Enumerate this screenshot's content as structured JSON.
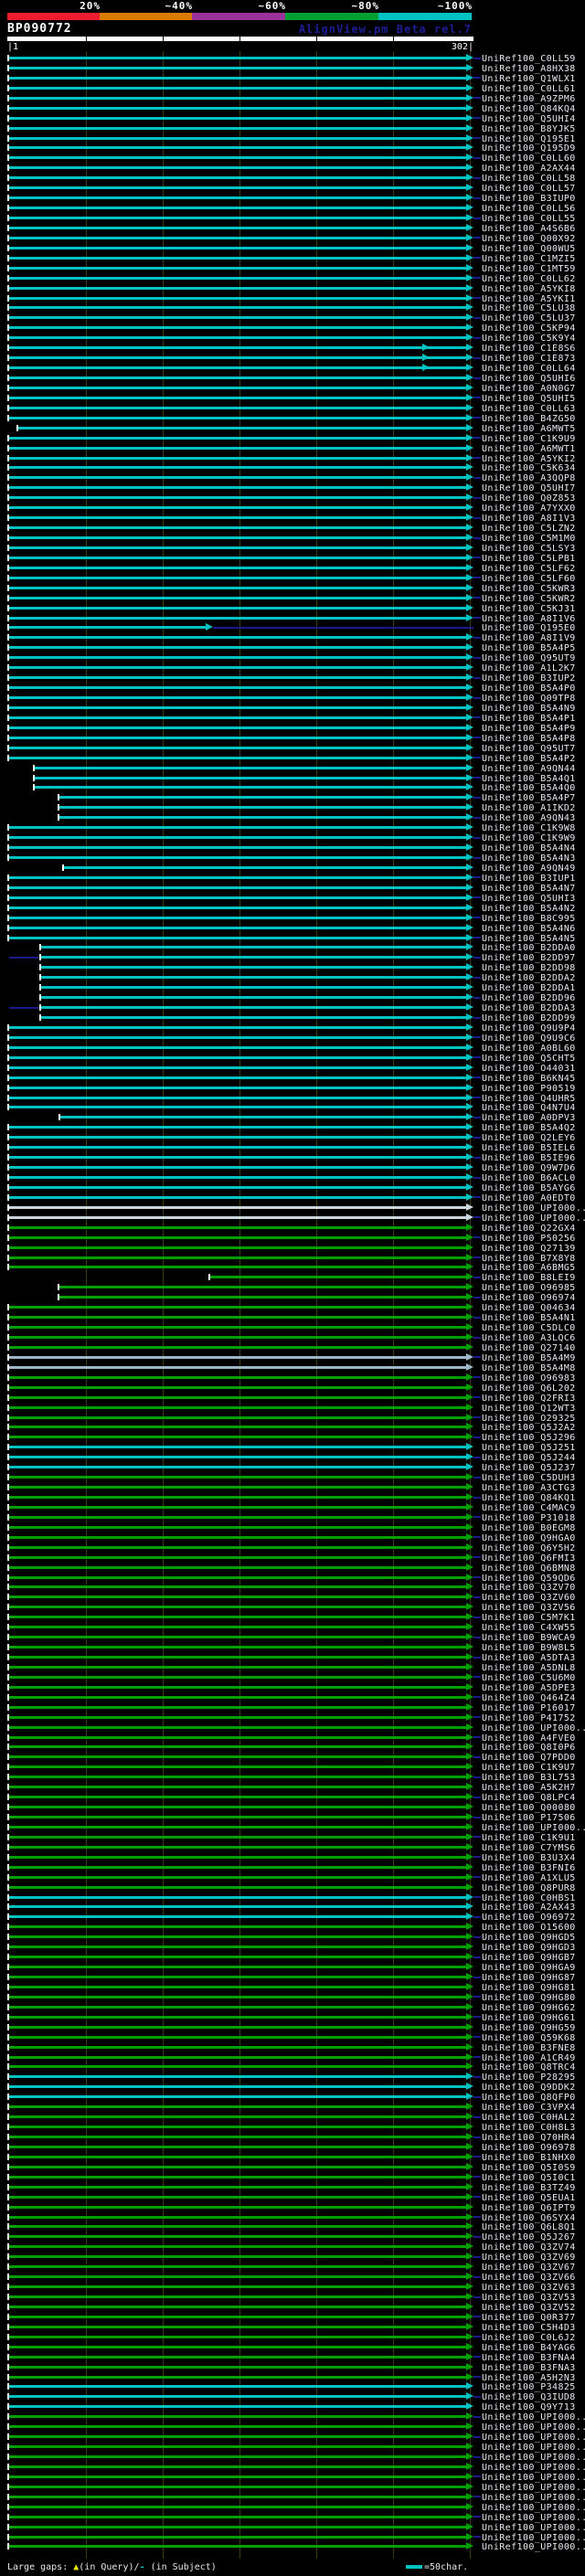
{
  "header": {
    "scale_labels": [
      "20%",
      "~40%",
      "~60%",
      "~80%",
      "~100%"
    ],
    "scale_colors": [
      "#ed1c2e",
      "#d97b00",
      "#993399",
      "#00a033",
      "#00c2c2"
    ],
    "query_id": "BP090772",
    "app_title": "AlignView.pm Beta rel.7",
    "ruler": {
      "start_label": "1",
      "end_label": "302|"
    }
  },
  "footer": {
    "large_gaps_prefix": "Large gaps: ",
    "query_gap_symbol": "▲",
    "query_gap_text": "(in Query)/",
    "subject_gap_symbol": "-",
    "subject_gap_text": " (in Subject)",
    "scale_bar_note": "=50char."
  },
  "colors": {
    "cyan": "#00c2c2",
    "green": "#00a000",
    "pale": "#c9d6dc",
    "steel": "#9db7c9",
    "navy": "#1a1a8c"
  },
  "alignment": {
    "rows": [
      {
        "label": "UniRef100_C0LL59"
      },
      {
        "label": "UniRef100_A8HX38"
      },
      {
        "label": "UniRef100_Q1WLX1"
      },
      {
        "label": "UniRef100_C0LL61"
      },
      {
        "label": "UniRef100_A9ZPM6"
      },
      {
        "label": "UniRef100_Q84KQ4"
      },
      {
        "label": "UniRef100_Q5UHI4"
      },
      {
        "label": "UniRef100_B8YJK5"
      },
      {
        "label": "UniRef100_Q195E1"
      },
      {
        "label": "UniRef100_Q195D9"
      },
      {
        "label": "UniRef100_C0LL60"
      },
      {
        "label": "UniRef100_A2AX44"
      },
      {
        "label": "UniRef100_C0LL58"
      },
      {
        "label": "UniRef100_C0LL57"
      },
      {
        "label": "UniRef100_B3IUP0"
      },
      {
        "label": "UniRef100_C0LL56"
      },
      {
        "label": "UniRef100_C0LL55"
      },
      {
        "label": "UniRef100_A4S6B6"
      },
      {
        "label": "UniRef100_Q00X92"
      },
      {
        "label": "UniRef100_Q00WU5"
      },
      {
        "label": "UniRef100_C1MZI5"
      },
      {
        "label": "UniRef100_C1MT59"
      },
      {
        "label": "UniRef100_C0LL62"
      },
      {
        "label": "UniRef100_A5YKI8"
      },
      {
        "label": "UniRef100_A5YKI1"
      },
      {
        "label": "UniRef100_C5LU38"
      },
      {
        "label": "UniRef100_C5LU37"
      },
      {
        "label": "UniRef100_C5KP94"
      },
      {
        "label": "UniRef100_C5K9Y4"
      },
      {
        "label": "UniRef100_C1E8S6",
        "m": 470
      },
      {
        "label": "UniRef100_C1E873",
        "m": 470
      },
      {
        "label": "UniRef100_C0LL64",
        "m": 470
      },
      {
        "label": "UniRef100_Q5UHI6"
      },
      {
        "label": "UniRef100_A0N0G7"
      },
      {
        "label": "UniRef100_Q5UHI5"
      },
      {
        "label": "UniRef100_C0LL63"
      },
      {
        "label": "UniRef100_B4ZG50"
      },
      {
        "label": "UniRef100_A6MWT5",
        "s": 20
      },
      {
        "label": "UniRef100_C1K9U9"
      },
      {
        "label": "UniRef100_A6MWT1"
      },
      {
        "label": "UniRef100_A5YKI2"
      },
      {
        "label": "UniRef100_C5K634"
      },
      {
        "label": "UniRef100_A3QQP8"
      },
      {
        "label": "UniRef100_Q5UHI7"
      },
      {
        "label": "UniRef100_Q0Z853"
      },
      {
        "label": "UniRef100_A7YXX0"
      },
      {
        "label": "UniRef100_A8I1V3"
      },
      {
        "label": "UniRef100_C5LZN2"
      },
      {
        "label": "UniRef100_C5M1M0"
      },
      {
        "label": "UniRef100_C5LSY3"
      },
      {
        "label": "UniRef100_C5LPB1"
      },
      {
        "label": "UniRef100_C5LF62"
      },
      {
        "label": "UniRef100_C5LF60"
      },
      {
        "label": "UniRef100_C5KWR3"
      },
      {
        "label": "UniRef100_C5KWR2"
      },
      {
        "label": "UniRef100_C5KJ31"
      },
      {
        "label": "UniRef100_A8I1V6"
      },
      {
        "label": "UniRef100_Q195E0",
        "e": 225,
        "tl": 1
      },
      {
        "label": "UniRef100_A8I1V9"
      },
      {
        "label": "UniRef100_B5A4P5"
      },
      {
        "label": "UniRef100_Q95UT9"
      },
      {
        "label": "UniRef100_A1L2K7"
      },
      {
        "label": "UniRef100_B3IUP2"
      },
      {
        "label": "UniRef100_B5A4P0"
      },
      {
        "label": "UniRef100_Q09TP8"
      },
      {
        "label": "UniRef100_B5A4N9"
      },
      {
        "label": "UniRef100_B5A4P1"
      },
      {
        "label": "UniRef100_B5A4P9"
      },
      {
        "label": "UniRef100_B5A4P8"
      },
      {
        "label": "UniRef100_Q95UT7"
      },
      {
        "label": "UniRef100_B5A4P2"
      },
      {
        "label": "UniRef100_A9QN44",
        "s": 38
      },
      {
        "label": "UniRef100_B5A4Q1",
        "s": 38
      },
      {
        "label": "UniRef100_B5A4Q0",
        "s": 38
      },
      {
        "label": "UniRef100_B5A4P7",
        "s": 65
      },
      {
        "label": "UniRef100_A1IKD2",
        "s": 65
      },
      {
        "label": "UniRef100_A9QN43",
        "s": 65
      },
      {
        "label": "UniRef100_C1K9W8"
      },
      {
        "label": "UniRef100_C1K9W9"
      },
      {
        "label": "UniRef100_B5A4N4"
      },
      {
        "label": "UniRef100_B5A4N3"
      },
      {
        "label": "UniRef100_A9QN49",
        "s": 70
      },
      {
        "label": "UniRef100_B3IUP1"
      },
      {
        "label": "UniRef100_B5A4N7"
      },
      {
        "label": "UniRef100_Q5UHI3"
      },
      {
        "label": "UniRef100_B5A4N2"
      },
      {
        "label": "UniRef100_B8C995"
      },
      {
        "label": "UniRef100_B5A4N6"
      },
      {
        "label": "UniRef100_B5A4N5"
      },
      {
        "label": "UniRef100_B2DDA0",
        "s": 45
      },
      {
        "label": "UniRef100_B2DD97",
        "s": 45,
        "ld": 1
      },
      {
        "label": "UniRef100_B2DD98",
        "s": 45
      },
      {
        "label": "UniRef100_B2DDA2",
        "s": 45
      },
      {
        "label": "UniRef100_B2DDA1",
        "s": 45
      },
      {
        "label": "UniRef100_B2DD96",
        "s": 45
      },
      {
        "label": "UniRef100_B2DDA3",
        "s": 45,
        "ld": 1
      },
      {
        "label": "UniRef100_B2DD99",
        "s": 45
      },
      {
        "label": "UniRef100_Q9U9P4"
      },
      {
        "label": "UniRef100_Q9U9C6"
      },
      {
        "label": "UniRef100_A0BL60"
      },
      {
        "label": "UniRef100_Q5CHT5"
      },
      {
        "label": "UniRef100_O44031"
      },
      {
        "label": "UniRef100_B6KN45"
      },
      {
        "label": "UniRef100_P90519"
      },
      {
        "label": "UniRef100_Q4UHR5"
      },
      {
        "label": "UniRef100_Q4N7U4"
      },
      {
        "label": "UniRef100_A0DPV3",
        "s": 66
      },
      {
        "label": "UniRef100_B5A4Q2"
      },
      {
        "label": "UniRef100_Q2LEY6"
      },
      {
        "label": "UniRef100_B5IEL6"
      },
      {
        "label": "UniRef100_B5IE96"
      },
      {
        "label": "UniRef100_Q9W7D6"
      },
      {
        "label": "UniRef100_B6ACL0"
      },
      {
        "label": "UniRef100_B5AYG6"
      },
      {
        "label": "UniRef100_A0EDT0"
      },
      {
        "label": "UniRef100_UPI000..",
        "c": "pale"
      },
      {
        "label": "UniRef100_UPI000..",
        "c": "pale"
      },
      {
        "label": "UniRef100_Q22GX4",
        "c": "green"
      },
      {
        "label": "UniRef100_P50256",
        "c": "green"
      },
      {
        "label": "UniRef100_Q27139",
        "c": "green"
      },
      {
        "label": "UniRef100_B7X8Y8",
        "c": "green"
      },
      {
        "label": "UniRef100_A6BMG5",
        "c": "green"
      },
      {
        "label": "UniRef100_B8LEI9",
        "c": "green",
        "s": 230
      },
      {
        "label": "UniRef100_O96985",
        "c": "green",
        "s": 65
      },
      {
        "label": "UniRef100_O96974",
        "c": "green",
        "s": 65
      },
      {
        "label": "UniRef100_Q04634",
        "c": "green"
      },
      {
        "label": "UniRef100_B5A4N1",
        "c": "green"
      },
      {
        "label": "UniRef100_C5DLC0",
        "c": "green"
      },
      {
        "label": "UniRef100_A3LQC6",
        "c": "green"
      },
      {
        "label": "UniRef100_Q27140",
        "c": "green"
      },
      {
        "label": "UniRef100_B5A4M9",
        "c": "steel"
      },
      {
        "label": "UniRef100_B5A4M8",
        "c": "steel"
      },
      {
        "label": "UniRef100_O96983",
        "c": "green"
      },
      {
        "label": "UniRef100_Q6L202",
        "c": "green"
      },
      {
        "label": "UniRef100_Q2FRI3",
        "c": "green"
      },
      {
        "label": "UniRef100_Q12WT3",
        "c": "green"
      },
      {
        "label": "UniRef100_O29325",
        "c": "green"
      },
      {
        "label": "UniRef100_Q5J2A2",
        "c": "green"
      },
      {
        "label": "UniRef100_Q5J296",
        "c": "green"
      },
      {
        "label": "UniRef100_Q5J251"
      },
      {
        "label": "UniRef100_Q5J244"
      },
      {
        "label": "UniRef100_Q5J237"
      },
      {
        "label": "UniRef100_C5DUH3",
        "c": "green"
      },
      {
        "label": "UniRef100_A3CTG3",
        "c": "green"
      },
      {
        "label": "UniRef100_Q84KQ1",
        "c": "green"
      },
      {
        "label": "UniRef100_C4MAC9",
        "c": "green"
      },
      {
        "label": "UniRef100_P31018",
        "c": "green"
      },
      {
        "label": "UniRef100_B0EGM8",
        "c": "green"
      },
      {
        "label": "UniRef100_Q9HGA0",
        "c": "green"
      },
      {
        "label": "UniRef100_Q6Y5H2",
        "c": "green"
      },
      {
        "label": "UniRef100_Q6FMI3",
        "c": "green"
      },
      {
        "label": "UniRef100_Q6BMN8",
        "c": "green"
      },
      {
        "label": "UniRef100_Q59QD6",
        "c": "green"
      },
      {
        "label": "UniRef100_Q3ZV70",
        "c": "green"
      },
      {
        "label": "UniRef100_Q3ZV60",
        "c": "green"
      },
      {
        "label": "UniRef100_Q3ZV56",
        "c": "green"
      },
      {
        "label": "UniRef100_C5M7K1",
        "c": "green"
      },
      {
        "label": "UniRef100_C4XW55",
        "c": "green"
      },
      {
        "label": "UniRef100_B9WCA9",
        "c": "green"
      },
      {
        "label": "UniRef100_B9W8L5",
        "c": "green"
      },
      {
        "label": "UniRef100_A5DTA3",
        "c": "green"
      },
      {
        "label": "UniRef100_A5DNL8",
        "c": "green"
      },
      {
        "label": "UniRef100_C5U6M0",
        "c": "green"
      },
      {
        "label": "UniRef100_A5DPE3",
        "c": "green"
      },
      {
        "label": "UniRef100_Q464Z4",
        "c": "green"
      },
      {
        "label": "UniRef100_P16017",
        "c": "green"
      },
      {
        "label": "UniRef100_P41752",
        "c": "green"
      },
      {
        "label": "UniRef100_UPI000..",
        "c": "green"
      },
      {
        "label": "UniRef100_A4FVE0",
        "c": "green"
      },
      {
        "label": "UniRef100_Q8I0P6",
        "c": "green"
      },
      {
        "label": "UniRef100_Q7PDD0",
        "c": "green"
      },
      {
        "label": "UniRef100_C1K9U7",
        "c": "green"
      },
      {
        "label": "UniRef100_B3L753",
        "c": "green"
      },
      {
        "label": "UniRef100_A5K2H7",
        "c": "green"
      },
      {
        "label": "UniRef100_Q8LPC4",
        "c": "green"
      },
      {
        "label": "UniRef100_Q00080",
        "c": "green"
      },
      {
        "label": "UniRef100_P17506",
        "c": "green"
      },
      {
        "label": "UniRef100_UPI000..",
        "c": "green"
      },
      {
        "label": "UniRef100_C1K9U1",
        "c": "green"
      },
      {
        "label": "UniRef100_C7YMS6",
        "c": "green"
      },
      {
        "label": "UniRef100_B3U3X4",
        "c": "green"
      },
      {
        "label": "UniRef100_B3FNI6",
        "c": "green"
      },
      {
        "label": "UniRef100_A1XLU5",
        "c": "green"
      },
      {
        "label": "UniRef100_Q8PUR8",
        "c": "green"
      },
      {
        "label": "UniRef100_C0HBS1"
      },
      {
        "label": "UniRef100_A2AX43"
      },
      {
        "label": "UniRef100_O96972"
      },
      {
        "label": "UniRef100_O15600",
        "c": "green"
      },
      {
        "label": "UniRef100_Q9HGD5",
        "c": "green"
      },
      {
        "label": "UniRef100_Q9HGD3",
        "c": "green"
      },
      {
        "label": "UniRef100_Q9HGB7",
        "c": "green"
      },
      {
        "label": "UniRef100_Q9HGA9",
        "c": "green"
      },
      {
        "label": "UniRef100_Q9HG87",
        "c": "green"
      },
      {
        "label": "UniRef100_Q9HG81",
        "c": "green"
      },
      {
        "label": "UniRef100_Q9HG80",
        "c": "green"
      },
      {
        "label": "UniRef100_Q9HG62",
        "c": "green"
      },
      {
        "label": "UniRef100_Q9HG61",
        "c": "green"
      },
      {
        "label": "UniRef100_Q9HG59",
        "c": "green"
      },
      {
        "label": "UniRef100_Q59K68",
        "c": "green"
      },
      {
        "label": "UniRef100_B3FNE8",
        "c": "green"
      },
      {
        "label": "UniRef100_A1CR49",
        "c": "green"
      },
      {
        "label": "UniRef100_Q8TRC4",
        "c": "green"
      },
      {
        "label": "UniRef100_P28295"
      },
      {
        "label": "UniRef100_Q9DDK2"
      },
      {
        "label": "UniRef100_Q8QFP0"
      },
      {
        "label": "UniRef100_C3VPX4",
        "c": "green"
      },
      {
        "label": "UniRef100_C0HAL2",
        "c": "green"
      },
      {
        "label": "UniRef100_C0H8L3",
        "c": "green"
      },
      {
        "label": "UniRef100_Q70HR4",
        "c": "green"
      },
      {
        "label": "UniRef100_O96978",
        "c": "green"
      },
      {
        "label": "UniRef100_B1NHX0",
        "c": "green"
      },
      {
        "label": "UniRef100_Q5I0S9",
        "c": "green"
      },
      {
        "label": "UniRef100_Q5I0C1",
        "c": "green"
      },
      {
        "label": "UniRef100_B3TZ49",
        "c": "green"
      },
      {
        "label": "UniRef100_Q5EUA1",
        "c": "green"
      },
      {
        "label": "UniRef100_Q6IPT9",
        "c": "green"
      },
      {
        "label": "UniRef100_Q6SYX4",
        "c": "green"
      },
      {
        "label": "UniRef100_Q6L8Q1",
        "c": "green"
      },
      {
        "label": "UniRef100_Q5J267",
        "c": "green"
      },
      {
        "label": "UniRef100_Q3ZV74",
        "c": "green"
      },
      {
        "label": "UniRef100_Q3ZV69",
        "c": "green"
      },
      {
        "label": "UniRef100_Q3ZV67",
        "c": "green"
      },
      {
        "label": "UniRef100_Q3ZV66",
        "c": "green"
      },
      {
        "label": "UniRef100_Q3ZV63",
        "c": "green"
      },
      {
        "label": "UniRef100_Q3ZV53",
        "c": "green"
      },
      {
        "label": "UniRef100_Q3ZV52",
        "c": "green"
      },
      {
        "label": "UniRef100_Q0R377",
        "c": "green"
      },
      {
        "label": "UniRef100_C5H4D3",
        "c": "green"
      },
      {
        "label": "UniRef100_C0L6J2",
        "c": "green"
      },
      {
        "label": "UniRef100_B4YAG6",
        "c": "green"
      },
      {
        "label": "UniRef100_B3FNA4",
        "c": "green"
      },
      {
        "label": "UniRef100_B3FNA3",
        "c": "green"
      },
      {
        "label": "UniRef100_A5H2N3",
        "c": "green"
      },
      {
        "label": "UniRef100_P34825"
      },
      {
        "label": "UniRef100_Q3IUD8"
      },
      {
        "label": "UniRef100_Q9Y713"
      },
      {
        "label": "UniRef100_UPI000..",
        "c": "green"
      },
      {
        "label": "UniRef100_UPI000..",
        "c": "green"
      },
      {
        "label": "UniRef100_UPI000..",
        "c": "green"
      },
      {
        "label": "UniRef100_UPI000..",
        "c": "green"
      },
      {
        "label": "UniRef100_UPI000..",
        "c": "green"
      },
      {
        "label": "UniRef100_UPI000..",
        "c": "green"
      },
      {
        "label": "UniRef100_UPI000..",
        "c": "green"
      },
      {
        "label": "UniRef100_UPI000..",
        "c": "green"
      },
      {
        "label": "UniRef100_UPI000..",
        "c": "green"
      },
      {
        "label": "UniRef100_UPI000..",
        "c": "green"
      },
      {
        "label": "UniRef100_UPI000..",
        "c": "green"
      },
      {
        "label": "UniRef100_UPI000..",
        "c": "green"
      },
      {
        "label": "UniRef100_UPI000..",
        "c": "green"
      },
      {
        "label": "UniRef100_UPI000..",
        "c": "green"
      }
    ]
  }
}
